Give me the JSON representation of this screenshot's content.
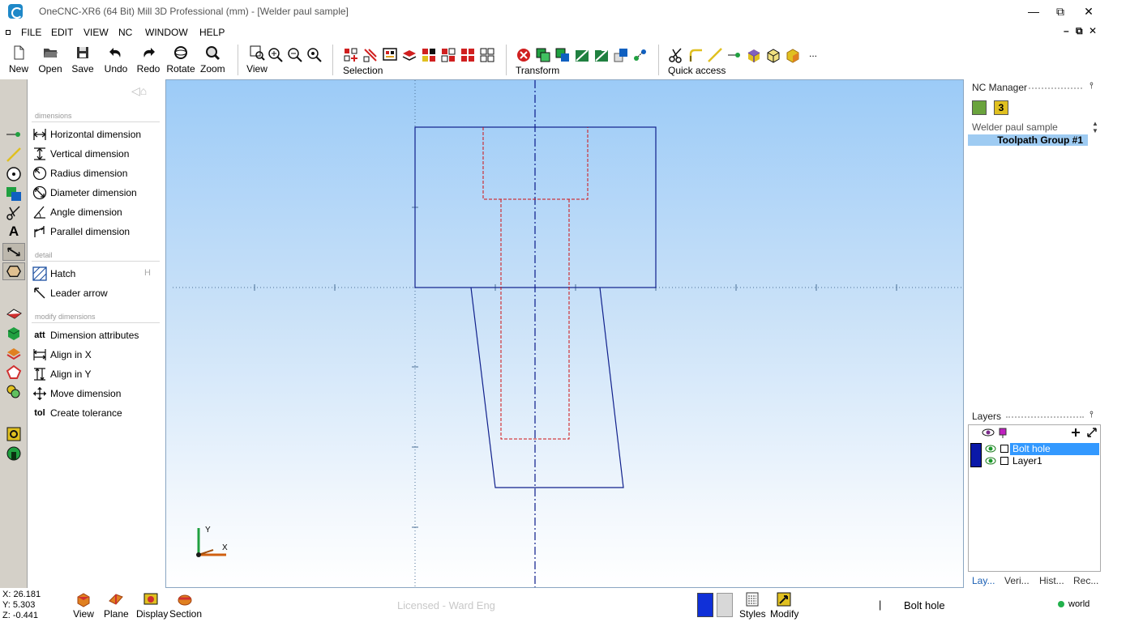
{
  "window": {
    "title": "OneCNC-XR6 (64 Bit) Mill 3D Professional (mm) - [Welder paul sample]",
    "minimize": "—",
    "restore": "⧉",
    "close": "✕"
  },
  "menu": {
    "items": [
      "FILE",
      "EDIT",
      "VIEW",
      "NC",
      "WINDOW",
      "HELP"
    ],
    "mdi_minimize": "–",
    "mdi_restore": "⧉",
    "mdi_close": "✕"
  },
  "toolbar": {
    "new": "New",
    "open": "Open",
    "save": "Save",
    "undo": "Undo",
    "redo": "Redo",
    "rotate": "Rotate",
    "zoom": "Zoom",
    "view": "View",
    "selection": "Selection",
    "transform": "Transform",
    "quick_access": "Quick access",
    "more": "..."
  },
  "dim_panel": {
    "sections": {
      "dimensions": "dimensions",
      "detail": "detail",
      "modify": "modify dimensions"
    },
    "dimensions": [
      {
        "label": "Horizontal dimension",
        "icon": "horizontal-dimension-icon"
      },
      {
        "label": "Vertical dimension",
        "icon": "vertical-dimension-icon"
      },
      {
        "label": "Radius dimension",
        "icon": "radius-dimension-icon"
      },
      {
        "label": "Diameter dimension",
        "icon": "diameter-dimension-icon"
      },
      {
        "label": "Angle dimension",
        "icon": "angle-dimension-icon"
      },
      {
        "label": "Parallel dimension",
        "icon": "parallel-dimension-icon"
      }
    ],
    "detail": [
      {
        "label": "Hatch",
        "shortcut": "H"
      },
      {
        "label": "Leader arrow"
      }
    ],
    "modify": [
      {
        "label": "Dimension attributes",
        "icon_text": "att"
      },
      {
        "label": "Align in X"
      },
      {
        "label": "Align in Y"
      },
      {
        "label": "Move dimension"
      },
      {
        "label": "Create tolerance",
        "icon_text": "tol"
      }
    ]
  },
  "viewport": {
    "axis_y": "Y",
    "axis_x": "X"
  },
  "nc_manager": {
    "title": "NC Manager",
    "file": "Welder paul sample",
    "group": "Toolpath Group #1",
    "icon_badge": "3"
  },
  "layers": {
    "title": "Layers",
    "rows": [
      {
        "name": "Bolt hole",
        "selected": true,
        "color": "#0a18a8"
      },
      {
        "name": "Layer1",
        "selected": false,
        "color": "#0a18a8"
      }
    ],
    "tabs": [
      "Lay...",
      "Veri...",
      "Hist...",
      "Rec..."
    ]
  },
  "status": {
    "x": "X: 26.181",
    "y": "Y: 5.303",
    "z": "Z: -0.441",
    "view": "View",
    "plane": "Plane",
    "display": "Display",
    "section": "Section",
    "license": "Licensed - Ward Eng",
    "styles": "Styles",
    "modify": "Modify",
    "separator": "|",
    "current_layer": "Bolt hole",
    "coord_system": "world"
  }
}
